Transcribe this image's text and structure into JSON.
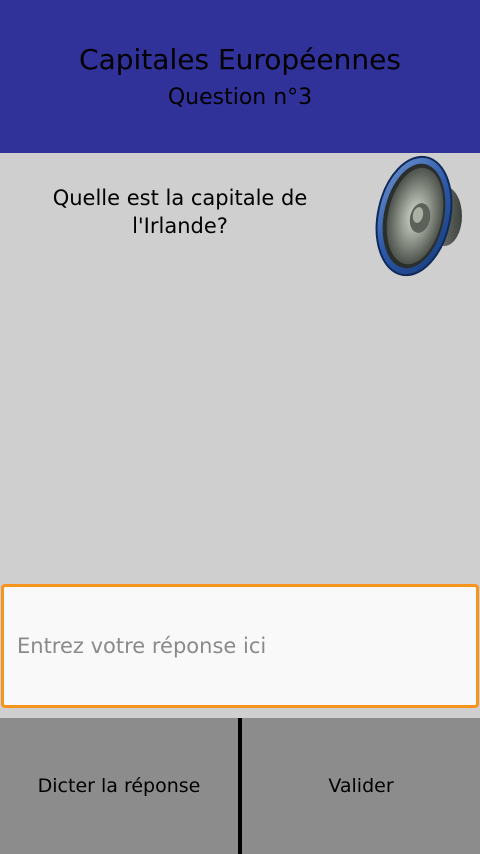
{
  "header": {
    "title": "Capitales Européennes",
    "question_number": "Question n°3"
  },
  "question": {
    "text": "Quelle est la capitale de l'Irlande?",
    "speaker_icon": "speaker-icon"
  },
  "answer": {
    "value": "",
    "placeholder": "Entrez votre réponse ici"
  },
  "buttons": {
    "dictate_label": "Dicter la réponse",
    "validate_label": "Valider"
  },
  "colors": {
    "header_bg": "#31319a",
    "content_bg": "#cfcfcf",
    "input_border": "#f7941d",
    "button_bar_bg": "#8c8c8c"
  }
}
